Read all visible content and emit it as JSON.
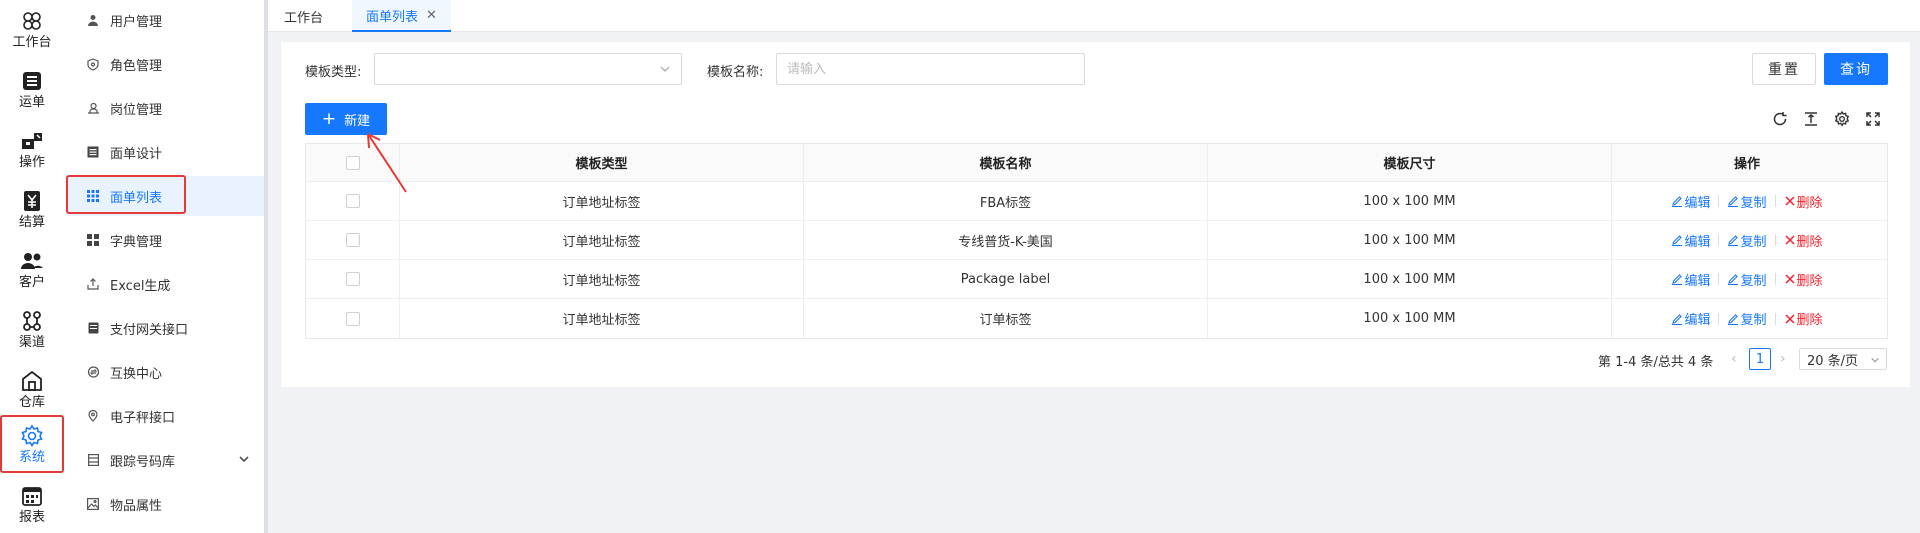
{
  "rail": {
    "items": [
      {
        "label": "工作台",
        "icon": "grid-clover-icon"
      },
      {
        "label": "运单",
        "icon": "list-icon"
      },
      {
        "label": "操作",
        "icon": "operate-icon"
      },
      {
        "label": "结算",
        "icon": "yen-icon"
      },
      {
        "label": "客户",
        "icon": "users-icon"
      },
      {
        "label": "渠道",
        "icon": "channel-icon"
      },
      {
        "label": "仓库",
        "icon": "warehouse-icon"
      },
      {
        "label": "系统",
        "icon": "gear-icon",
        "selected": true
      },
      {
        "label": "报表",
        "icon": "calendar-icon"
      }
    ]
  },
  "submenu": {
    "items": [
      {
        "label": "用户管理",
        "icon": "user-icon"
      },
      {
        "label": "角色管理",
        "icon": "shield-icon"
      },
      {
        "label": "岗位管理",
        "icon": "post-icon"
      },
      {
        "label": "面单设计",
        "icon": "design-icon"
      },
      {
        "label": "面单列表",
        "icon": "grid-icon",
        "active": true
      },
      {
        "label": "字典管理",
        "icon": "dict-icon"
      },
      {
        "label": "Excel生成",
        "icon": "export-icon"
      },
      {
        "label": "支付网关接口",
        "icon": "card-icon"
      },
      {
        "label": "互换中心",
        "icon": "swap-icon"
      },
      {
        "label": "电子秤接口",
        "icon": "pin-icon"
      },
      {
        "label": "跟踪号码库",
        "icon": "db-icon"
      },
      {
        "label": "物品属性",
        "icon": "image-icon"
      }
    ]
  },
  "tabs": [
    {
      "label": "工作台"
    },
    {
      "label": "面单列表",
      "active": true
    }
  ],
  "filters": {
    "type_label": "模板类型:",
    "type_value": "",
    "name_label": "模板名称:",
    "name_placeholder": "请输入"
  },
  "buttons": {
    "reset": "重置",
    "query": "查询",
    "new": "新建"
  },
  "toolbar_icons": [
    "refresh-icon",
    "column-height-icon",
    "settings-icon",
    "fullscreen-icon"
  ],
  "table": {
    "columns": [
      "模板类型",
      "模板名称",
      "模板尺寸",
      "操作"
    ],
    "rows": [
      {
        "type": "订单地址标签",
        "name": "FBA标签",
        "size": "100 x 100 MM"
      },
      {
        "type": "订单地址标签",
        "name": "专线普货-K-美国",
        "size": "100 x 100 MM"
      },
      {
        "type": "订单地址标签",
        "name": "Package label",
        "size": "100 x 100 MM"
      },
      {
        "type": "订单地址标签",
        "name": "订单标签",
        "size": "100 x 100 MM"
      }
    ],
    "actions": {
      "edit": "编辑",
      "copy": "复制",
      "delete": "删除"
    }
  },
  "pagination": {
    "total_text": "第 1-4 条/总共 4 条",
    "current_page": "1",
    "page_size": "20 条/页"
  },
  "colors": {
    "primary": "#1677ff",
    "danger": "#f5222d",
    "highlight": "#e53935"
  }
}
